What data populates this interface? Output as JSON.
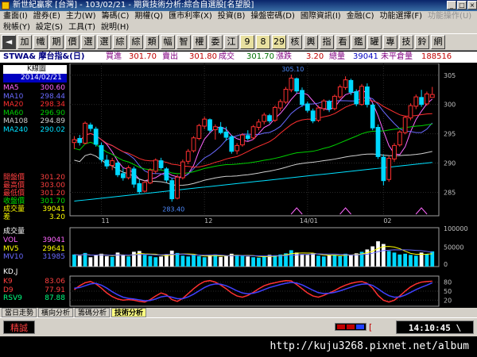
{
  "window": {
    "title": "新世紀贏家 [台灣] - 103/02/21 - 期貨技術分析:綜合自選股[名望股]",
    "buttons": [
      "_",
      "□",
      "×"
    ]
  },
  "menu": {
    "row1": [
      {
        "label": "畫面(I)",
        "enabled": true
      },
      {
        "label": "證券(E)",
        "enabled": true
      },
      {
        "label": "主力(W)",
        "enabled": true
      },
      {
        "label": "籌碼(C)",
        "enabled": true
      },
      {
        "label": "期權(Q)",
        "enabled": true
      },
      {
        "label": "匯市利率(X)",
        "enabled": true
      },
      {
        "label": "投資(B)",
        "enabled": true
      },
      {
        "label": "操盤密碼(D)",
        "enabled": true
      },
      {
        "label": "國際資訊(I)",
        "enabled": true
      },
      {
        "label": "金融(C)",
        "enabled": true
      },
      {
        "label": "功能選擇(F)",
        "enabled": true
      },
      {
        "label": "功能操作(U)",
        "enabled": false
      }
    ],
    "row2": [
      {
        "label": "稅帳(Y)",
        "enabled": true
      },
      {
        "label": "設定(S)",
        "enabled": true
      },
      {
        "label": "工具(T)",
        "enabled": true
      },
      {
        "label": "說明(H)",
        "enabled": true
      }
    ]
  },
  "toolbar": {
    "buttons": [
      {
        "label": "◄",
        "style": "dark"
      },
      {
        "label": "加",
        "style": "plain"
      },
      {
        "label": "幟",
        "style": "plain"
      },
      {
        "label": "期",
        "style": "plain"
      },
      {
        "label": "價",
        "style": "plain"
      },
      {
        "label": "選",
        "style": "plain"
      },
      {
        "label": "選",
        "style": "plain"
      },
      {
        "label": "綜",
        "style": "plain"
      },
      {
        "label": "綜",
        "style": "plain"
      },
      {
        "label": "類",
        "style": "plain"
      },
      {
        "label": "幅",
        "style": "plain"
      },
      {
        "label": "智",
        "style": "plain"
      },
      {
        "label": "權",
        "style": "plain"
      },
      {
        "label": "委",
        "style": "plain"
      },
      {
        "label": "江",
        "style": "plain"
      },
      {
        "label": "9",
        "style": "yellow"
      },
      {
        "label": "8",
        "style": "yellow"
      },
      {
        "label": "29",
        "style": "yellow"
      },
      {
        "label": "核",
        "style": "plain"
      },
      {
        "label": "輿",
        "style": "plain"
      },
      {
        "label": "指",
        "style": "plain"
      },
      {
        "label": "看",
        "style": "plain"
      },
      {
        "label": "鑑",
        "style": "plain"
      },
      {
        "label": "罐",
        "style": "plain"
      },
      {
        "label": "專",
        "style": "plain"
      },
      {
        "label": "技",
        "style": "plain"
      },
      {
        "label": "鈴",
        "style": "plain"
      },
      {
        "label": "網",
        "style": "plain"
      }
    ]
  },
  "quote": {
    "symbol": "STWA& 摩台指&(日)",
    "buy_label": "買進",
    "buy_value": "301.70",
    "sell_label": "賣出",
    "sell_value": "301.80",
    "deal_label": "成交",
    "deal_value": "301.70",
    "change_label": "漲跌",
    "change_value": "3.20",
    "volume_label": "總量",
    "volume_value": "39041",
    "oi_label": "未平倉量",
    "oi_value": "188516"
  },
  "main_legend": {
    "chart_label": "K線圖",
    "date": "2014/02/21",
    "ma": [
      {
        "name": "MA5",
        "value": "300.60",
        "color": "#ff66ff"
      },
      {
        "name": "MA10",
        "value": "298.44",
        "color": "#6a6aff"
      },
      {
        "name": "MA20",
        "value": "298.34",
        "color": "#ff3030"
      },
      {
        "name": "MA60",
        "value": "296.90",
        "color": "#00d000"
      },
      {
        "name": "MA108",
        "value": "294.89",
        "color": "#d0d0d0"
      },
      {
        "name": "MA240",
        "value": "290.02",
        "color": "#00e0ff"
      }
    ],
    "ohlc": [
      {
        "name": "開盤價",
        "value": "301.20",
        "color": "#ff4040"
      },
      {
        "name": "最高價",
        "value": "303.00",
        "color": "#ff4040"
      },
      {
        "name": "最低價",
        "value": "301.20",
        "color": "#ff4040"
      },
      {
        "name": "收盤價",
        "value": "301.70",
        "color": "#00e000"
      },
      {
        "name": "成交量",
        "value": "39041",
        "color": "#ffff00"
      },
      {
        "name": "差",
        "value": "3.20",
        "color": "#ffff00"
      }
    ]
  },
  "volume_legend": {
    "title": "成交量",
    "items": [
      {
        "name": "VOL",
        "value": "39041",
        "color": "#ff66ff"
      },
      {
        "name": "MV5",
        "value": "29641",
        "color": "#ffff00"
      },
      {
        "name": "MV10",
        "value": "31985",
        "color": "#6a6aff"
      }
    ],
    "axis": [
      "100000",
      "50000",
      "0"
    ]
  },
  "kd_legend": {
    "title": "KD,J",
    "items": [
      {
        "name": "K9",
        "value": "83.06",
        "color": "#ff4040"
      },
      {
        "name": "D9",
        "value": "77.91",
        "color": "#ff4040"
      },
      {
        "name": "RSV9",
        "value": "87.88",
        "color": "#00ff80"
      }
    ],
    "axis": [
      "80",
      "50",
      "20"
    ]
  },
  "chart_data": [
    {
      "type": "candlestick",
      "title": "K線圖",
      "ylim": [
        281,
        307
      ],
      "y_ticks": [
        305,
        300,
        295,
        290,
        285
      ],
      "x_ticks": [
        "11",
        "12",
        "14/01",
        "02"
      ],
      "high_label": "305.10",
      "low_label": "283.40",
      "ohlc": [
        [
          293.5,
          294.6,
          292.4,
          294.0
        ],
        [
          294.2,
          294.8,
          293.0,
          293.5
        ],
        [
          293.4,
          297.1,
          293.2,
          296.8
        ],
        [
          296.5,
          296.9,
          295.4,
          295.9
        ],
        [
          295.8,
          296.2,
          292.8,
          293.2
        ],
        [
          293.0,
          293.5,
          290.1,
          290.6
        ],
        [
          290.5,
          291.4,
          289.0,
          289.5
        ],
        [
          289.6,
          290.9,
          288.8,
          290.4
        ],
        [
          290.0,
          290.4,
          287.6,
          288.0
        ],
        [
          288.2,
          289.1,
          287.0,
          287.5
        ],
        [
          287.5,
          289.6,
          287.2,
          289.2
        ],
        [
          289.0,
          289.4,
          285.8,
          286.4
        ],
        [
          286.5,
          287.2,
          284.8,
          285.1
        ],
        [
          285.2,
          287.0,
          285.0,
          286.7
        ],
        [
          286.6,
          289.1,
          286.4,
          288.8
        ],
        [
          288.6,
          290.8,
          288.2,
          290.5
        ],
        [
          290.4,
          290.9,
          288.9,
          289.2
        ],
        [
          289.0,
          289.3,
          286.7,
          287.1
        ],
        [
          287.0,
          287.4,
          283.4,
          283.9
        ],
        [
          284.0,
          288.0,
          283.8,
          287.6
        ],
        [
          287.5,
          290.6,
          287.2,
          290.2
        ],
        [
          290.3,
          292.4,
          289.8,
          292.0
        ],
        [
          292.1,
          294.6,
          291.8,
          294.3
        ],
        [
          294.2,
          296.7,
          293.9,
          296.4
        ],
        [
          296.3,
          297.9,
          295.8,
          297.5
        ],
        [
          297.4,
          297.6,
          295.2,
          295.6
        ],
        [
          295.7,
          296.6,
          294.0,
          296.2
        ],
        [
          296.1,
          297.0,
          294.9,
          295.2
        ],
        [
          295.3,
          296.2,
          293.8,
          294.4
        ],
        [
          294.5,
          294.8,
          291.6,
          292.0
        ],
        [
          292.1,
          293.4,
          291.5,
          293.0
        ],
        [
          293.1,
          295.1,
          292.8,
          294.8
        ],
        [
          294.7,
          295.6,
          293.8,
          294.2
        ],
        [
          294.3,
          296.5,
          294.0,
          296.2
        ],
        [
          296.1,
          297.5,
          295.6,
          297.0
        ],
        [
          297.1,
          298.6,
          296.6,
          298.2
        ],
        [
          298.1,
          298.4,
          296.8,
          297.2
        ],
        [
          297.3,
          299.8,
          297.0,
          299.5
        ],
        [
          299.4,
          300.9,
          298.9,
          300.5
        ],
        [
          300.4,
          303.0,
          300.1,
          302.6
        ],
        [
          302.5,
          305.1,
          302.1,
          304.5
        ],
        [
          304.4,
          304.6,
          301.9,
          302.3
        ],
        [
          302.4,
          302.9,
          299.6,
          300.0
        ],
        [
          300.1,
          300.5,
          298.6,
          299.0
        ],
        [
          298.9,
          299.3,
          296.8,
          297.2
        ],
        [
          297.3,
          299.8,
          297.0,
          299.4
        ],
        [
          299.3,
          300.9,
          298.9,
          300.6
        ],
        [
          300.5,
          300.8,
          298.7,
          299.2
        ],
        [
          299.3,
          301.7,
          299.0,
          301.4
        ],
        [
          301.3,
          303.4,
          301.0,
          303.0
        ],
        [
          302.9,
          304.8,
          302.5,
          304.2
        ],
        [
          304.1,
          304.4,
          301.6,
          302.1
        ],
        [
          302.2,
          302.6,
          299.7,
          300.1
        ],
        [
          300.0,
          303.5,
          299.8,
          303.1
        ],
        [
          303.0,
          303.6,
          299.5,
          300.0
        ],
        [
          299.9,
          300.2,
          295.6,
          296.0
        ],
        [
          296.1,
          296.6,
          290.7,
          291.1
        ],
        [
          291.0,
          291.5,
          286.2,
          287.0
        ],
        [
          287.2,
          291.2,
          286.8,
          290.8
        ],
        [
          290.7,
          293.4,
          290.2,
          293.0
        ],
        [
          293.1,
          295.6,
          292.8,
          295.3
        ],
        [
          295.2,
          298.1,
          294.9,
          297.8
        ],
        [
          297.7,
          300.2,
          297.3,
          299.8
        ],
        [
          299.7,
          301.7,
          299.2,
          301.3
        ],
        [
          301.2,
          302.5,
          299.6,
          300.0
        ],
        [
          300.1,
          302.2,
          299.8,
          301.8
        ],
        [
          301.2,
          303.0,
          301.2,
          301.7
        ]
      ]
    },
    {
      "type": "bar",
      "title": "成交量",
      "ylim": [
        0,
        100000
      ],
      "values": [
        31000,
        28000,
        35000,
        24000,
        30000,
        33000,
        27000,
        25000,
        36000,
        29000,
        26000,
        38000,
        40000,
        30000,
        27000,
        24000,
        26000,
        32000,
        41000,
        35000,
        28000,
        26000,
        30000,
        27000,
        24000,
        29000,
        31000,
        25000,
        27000,
        33000,
        30000,
        28000,
        26000,
        24000,
        23000,
        27000,
        30000,
        29000,
        31000,
        34000,
        42000,
        36000,
        32000,
        30000,
        34000,
        28000,
        26000,
        29000,
        30000,
        27000,
        33000,
        30000,
        34000,
        38000,
        44000,
        52000,
        65000,
        58000,
        40000,
        36000,
        31000,
        33000,
        30000,
        28000,
        36000,
        32000,
        39041
      ]
    },
    {
      "type": "line",
      "title": "KD,J",
      "ylim": [
        0,
        100
      ],
      "series": [
        {
          "name": "K9",
          "color": "#ff3030",
          "values": [
            55,
            68,
            78,
            82,
            74,
            60,
            44,
            32,
            24,
            20,
            22,
            20,
            16,
            14,
            22,
            34,
            44,
            38,
            22,
            16,
            26,
            42,
            58,
            72,
            82,
            85,
            80,
            70,
            58,
            44,
            34,
            30,
            36,
            46,
            58,
            68,
            74,
            78,
            82,
            85,
            84,
            72,
            58,
            44,
            34,
            30,
            36,
            44,
            52,
            62,
            70,
            76,
            80,
            82,
            76,
            60,
            36,
            20,
            14,
            20,
            34,
            50,
            64,
            74,
            80,
            82,
            83.06
          ]
        },
        {
          "name": "D9",
          "color": "#4040ff",
          "values": [
            60,
            62,
            68,
            74,
            76,
            70,
            60,
            48,
            38,
            30,
            26,
            24,
            21,
            18,
            19,
            24,
            31,
            34,
            30,
            25,
            25,
            31,
            40,
            51,
            62,
            70,
            74,
            73,
            68,
            60,
            51,
            44,
            41,
            43,
            48,
            55,
            62,
            67,
            72,
            76,
            79,
            77,
            71,
            62,
            53,
            45,
            42,
            43,
            46,
            51,
            57,
            63,
            69,
            73,
            74,
            69,
            58,
            45,
            35,
            30,
            31,
            37,
            46,
            55,
            63,
            70,
            77.91
          ]
        }
      ]
    }
  ],
  "tabs": [
    {
      "label": "當日走勢",
      "active": false
    },
    {
      "label": "橫向分析",
      "active": false
    },
    {
      "label": "籌碼分析",
      "active": false
    },
    {
      "label": "技術分析",
      "active": true
    }
  ],
  "status": {
    "mode": "精誠",
    "bracket": "[",
    "time": "14:10:45",
    "time_bracket": "\\"
  },
  "watermark": "http://kuju3268.pixnet.net/album"
}
